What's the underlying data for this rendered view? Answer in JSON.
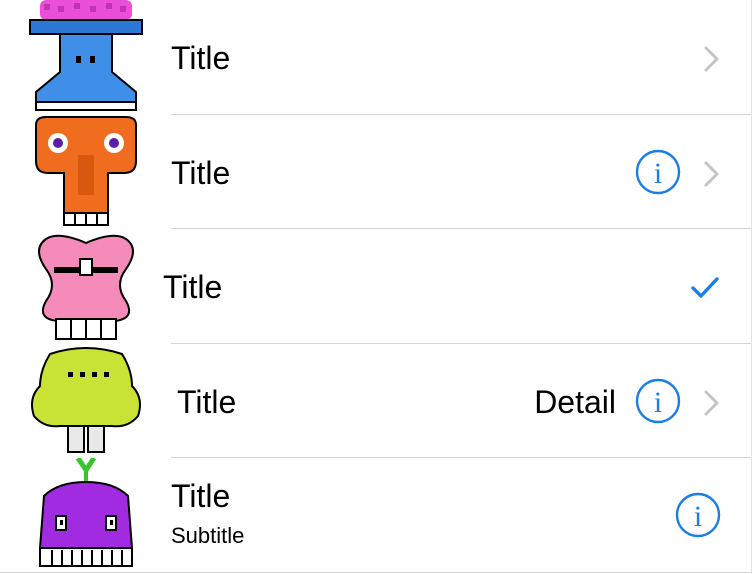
{
  "colors": {
    "accent": "#1a7ee8",
    "chevron": "#c4c4c8",
    "separator": "#d6d6da"
  },
  "rows": [
    {
      "title": "Title",
      "thumbnail": "blue-monster-icon",
      "accessory": "chevron"
    },
    {
      "title": "Title",
      "thumbnail": "orange-monster-icon",
      "accessory": "detail-disclosure"
    },
    {
      "title": "Title",
      "thumbnail": "pink-monster-icon",
      "accessory": "checkmark"
    },
    {
      "title": "Title",
      "detail": "Detail",
      "thumbnail": "green-monster-icon",
      "accessory": "detail-disclosure"
    },
    {
      "title": "Title",
      "subtitle": "Subtitle",
      "thumbnail": "purple-monster-icon",
      "accessory": "info"
    }
  ]
}
